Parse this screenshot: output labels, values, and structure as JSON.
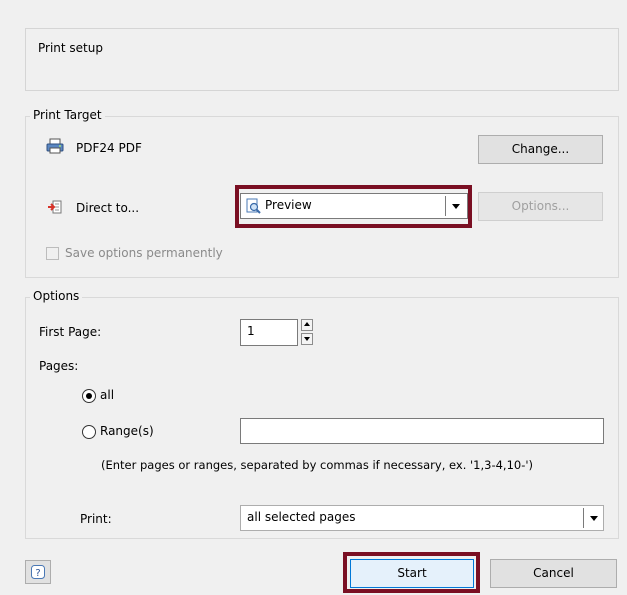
{
  "print_setup": {
    "label": "Print setup"
  },
  "print_target": {
    "legend": "Print Target",
    "printer_name": "PDF24 PDF",
    "change_button": "Change...",
    "direct_to_label": "Direct to...",
    "direct_to_value": "Preview",
    "options_button": "Options...",
    "save_options_label": "Save options permanently",
    "save_options_checked": false
  },
  "options": {
    "legend": "Options",
    "first_page_label": "First Page:",
    "first_page_value": "1",
    "pages_label": "Pages:",
    "all_label": "all",
    "all_selected": true,
    "range_label": "Range(s)",
    "range_value": "",
    "hint": "(Enter pages or ranges, separated by commas if necessary, ex. '1,3-4,10-')",
    "print_label": "Print:",
    "print_value": "all selected pages"
  },
  "footer": {
    "help_icon": "help-icon",
    "start_button": "Start",
    "cancel_button": "Cancel"
  },
  "colors": {
    "highlight": "#7a0f23",
    "background": "#f0f0f0"
  }
}
